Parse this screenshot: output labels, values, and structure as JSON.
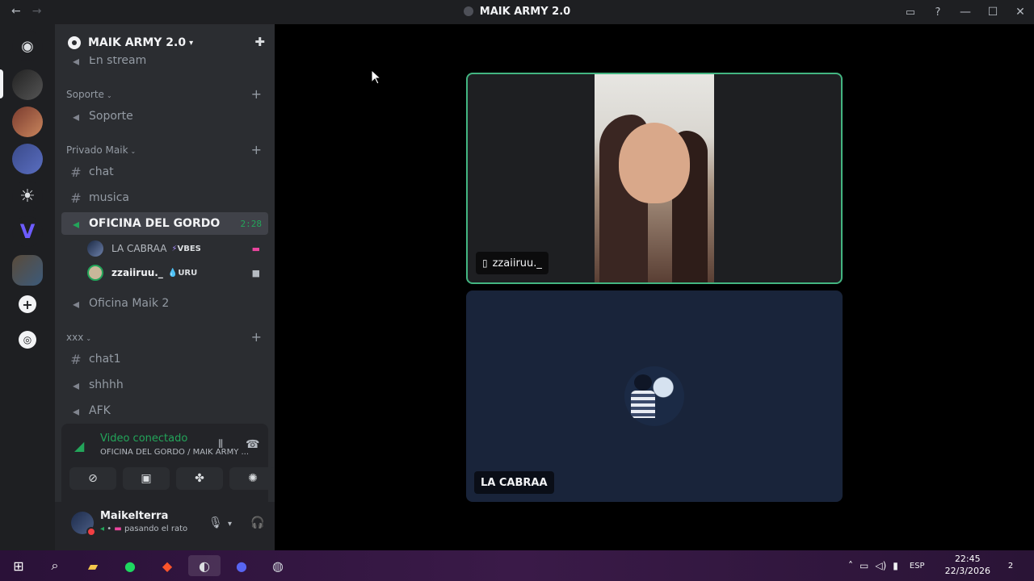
{
  "window": {
    "title": "MAIK ARMY 2.0",
    "back_icon": "←",
    "forward_icon": "→"
  },
  "server": {
    "name": "MAIK ARMY 2.0",
    "partial_channel": "En stream"
  },
  "categories": [
    {
      "label": "Soporte"
    },
    {
      "label": "Privado Maik"
    },
    {
      "label": "xxx"
    }
  ],
  "channels": {
    "soporte": "Soporte",
    "chat": "chat",
    "musica": "musica",
    "oficina": "OFICINA DEL GORDO",
    "oficina_time": "2:28",
    "oficina2": "Oficina Maik 2",
    "chat1": "chat1",
    "shhhh": "shhhh",
    "afk": "AFK"
  },
  "voice_users": [
    {
      "name": "LA CABRAA",
      "tag": "VBES",
      "tag_icon": "⚡"
    },
    {
      "name": "zzaiiruu._",
      "tag": "URU",
      "tag_icon": "💧"
    }
  ],
  "voice_panel": {
    "status": "Video conectado",
    "location": "OFICINA DEL GORDO / MAIK ARMY ..."
  },
  "user": {
    "name": "Maikelterra",
    "activity": "pasando el rato"
  },
  "stage": {
    "tile1_name": "zzaiiruu._",
    "tile2_name": "LA CABRAA"
  },
  "taskbar": {
    "lang": "ESP",
    "time": "22:45",
    "date": "22/3/2026",
    "notifications": "2"
  },
  "colors": {
    "accent_green": "#23a55a",
    "speaking_border": "#43b581",
    "rail": "#1e1f22",
    "sidebar": "#2b2d31"
  }
}
